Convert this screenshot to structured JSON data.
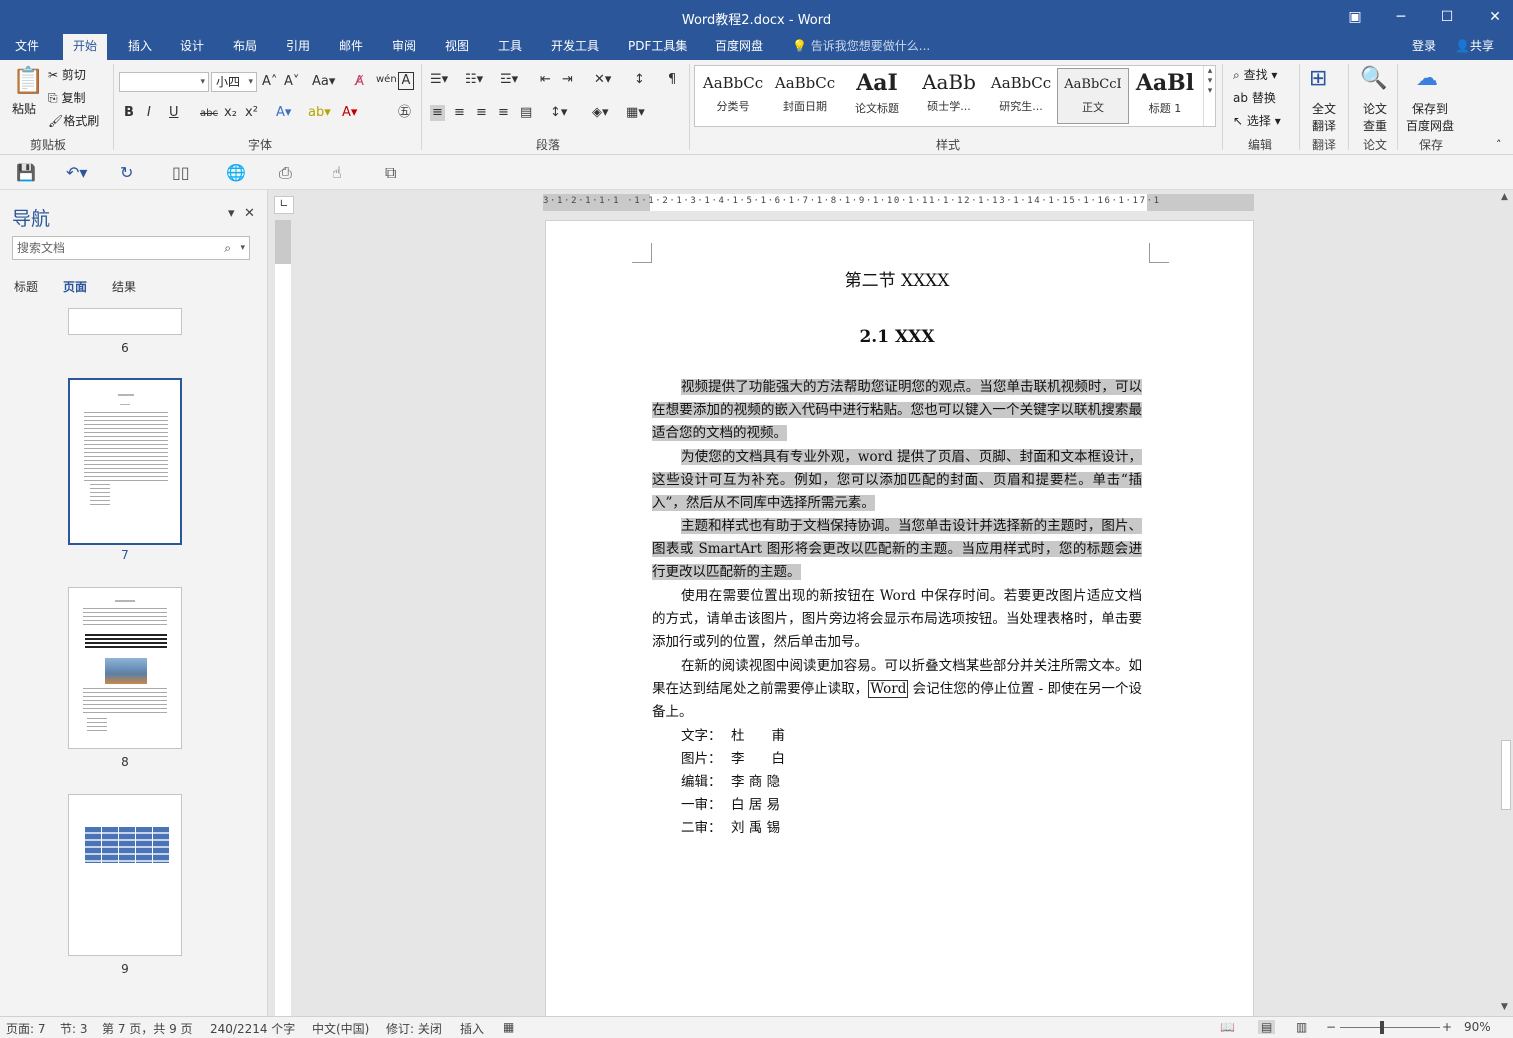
{
  "window": {
    "title": "Word教程2.docx - Word"
  },
  "tabs": [
    "文件",
    "开始",
    "插入",
    "设计",
    "布局",
    "引用",
    "邮件",
    "审阅",
    "视图",
    "工具",
    "开发工具",
    "PDF工具集",
    "百度网盘"
  ],
  "tell_me": "告诉我您想要做什么...",
  "account": {
    "login": "登录",
    "share": "共享"
  },
  "clipboard": {
    "paste": "粘贴",
    "cut": "剪切",
    "copy": "复制",
    "format_painter": "格式刷",
    "label": "剪贴板"
  },
  "font": {
    "name": "",
    "size": "小四",
    "label": "字体",
    "bold": "B",
    "italic": "I",
    "underline": "U",
    "strike": "abc",
    "sub": "x₂",
    "sup": "x²",
    "wen": "wén"
  },
  "paragraph": {
    "label": "段落"
  },
  "styles": {
    "label": "样式",
    "items": [
      {
        "sample": "AaBbCc",
        "name": "分类号"
      },
      {
        "sample": "AaBbCc",
        "name": "封面日期"
      },
      {
        "sample": "AaI",
        "name": "论文标题"
      },
      {
        "sample": "AaBb",
        "name": "硕士学..."
      },
      {
        "sample": "AaBbCc",
        "name": "研究生..."
      },
      {
        "sample": "AaBbCcI",
        "name": "正文"
      },
      {
        "sample": "AaBl",
        "name": "标题 1"
      }
    ]
  },
  "editing": {
    "find": "查找",
    "replace": "替换",
    "select": "选择",
    "label": "编辑"
  },
  "translate": {
    "btn1": "全文",
    "btn2": "翻译",
    "label": "翻译"
  },
  "thesis": {
    "btn1": "论文",
    "btn2": "查重",
    "label": "论文"
  },
  "save_baidu": {
    "btn1": "保存到",
    "btn2": "百度网盘",
    "label": "保存"
  },
  "nav": {
    "title": "导航",
    "search_placeholder": "搜索文档",
    "tabs": [
      "标题",
      "页面",
      "结果"
    ],
    "pages": [
      "6",
      "7",
      "8",
      "9"
    ]
  },
  "document": {
    "section_title": "第二节  XXXX",
    "subsection_title": "2.1 XXX",
    "p1": "视频提供了功能强大的方法帮助您证明您的观点。当您单击联机视频时，可以在想要添加的视频的嵌入代码中进行粘贴。您也可以键入一个关键字以联机搜索最适合您的文档的视频。",
    "p2": "为使您的文档具有专业外观，word 提供了页眉、页脚、封面和文本框设计，这些设计可互为补充。例如，您可以添加匹配的封面、页眉和提要栏。单击“插入”，然后从不同库中选择所需元素。",
    "p3": "主题和样式也有助于文档保持协调。当您单击设计并选择新的主题时，图片、图表或 SmartArt 图形将会更改以匹配新的主题。当应用样式时，您的标题会进行更改以匹配新的主题。",
    "p4": "使用在需要位置出现的新按钮在 Word 中保存时间。若要更改图片适应文档的方式，请单击该图片，图片旁边将会显示布局选项按钮。当处理表格时，单击要添加行或列的位置，然后单击加号。",
    "p5a": "在新的阅读视图中阅读更加容易。可以折叠文档某些部分并关注所需文本。如果在达到结尾处之前需要停止读取，",
    "p5_word": "Word",
    "p5b": " 会记住您的停止位置 - 即使在另一个设备上。",
    "credits": [
      {
        "label": "文字：",
        "name": "杜　　甫"
      },
      {
        "label": "图片：",
        "name": "李　　白"
      },
      {
        "label": "编辑：",
        "name": "李 商 隐"
      },
      {
        "label": "一审：",
        "name": "白 居 易"
      },
      {
        "label": "二审：",
        "name": "刘 禹 锡"
      }
    ]
  },
  "statusbar": {
    "page": "页面: 7",
    "section": "节: 3",
    "page_of": "第 7 页，共 9 页",
    "words": "240/2214 个字",
    "lang": "中文(中国)",
    "track": "修订: 关闭",
    "insert": "插入",
    "zoom": "90%"
  }
}
